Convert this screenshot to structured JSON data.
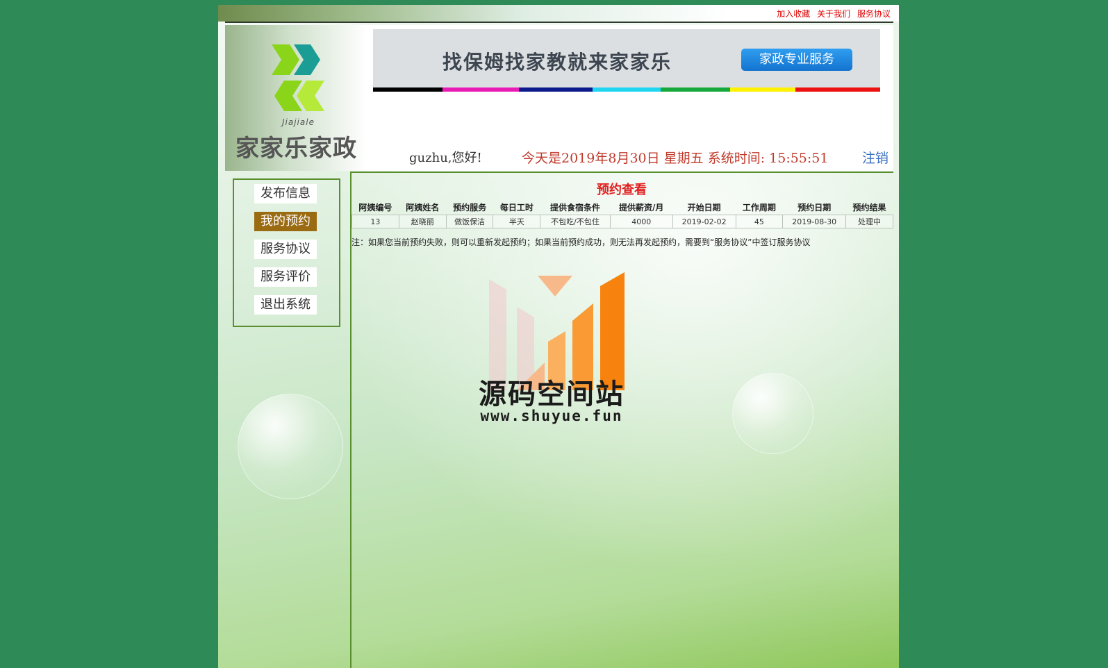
{
  "top_links": [
    "加入收藏",
    "关于我们",
    "服务协议"
  ],
  "logo": {
    "small_text": "Jiajiale",
    "name": "家家乐家政"
  },
  "banner": {
    "title": "找保姆找家教就来家家乐",
    "button": "家政专业服务",
    "stripe_colors": [
      "#000000",
      "#e81cb4",
      "#0d1a8c",
      "#20d5f0",
      "#16a83a",
      "#fff200",
      "#ee1111"
    ]
  },
  "user_bar": {
    "welcome": "guzhu,您好!",
    "datetime": "今天是2019年8月30日 星期五 系统时间: 15:55:51",
    "logout": "注销"
  },
  "sidebar": {
    "items": [
      {
        "label": "发布信息"
      },
      {
        "label": "我的预约"
      },
      {
        "label": "服务协议"
      },
      {
        "label": "服务评价"
      },
      {
        "label": "退出系统"
      }
    ]
  },
  "main": {
    "title": "预约查看",
    "columns": [
      "阿姨编号",
      "阿姨姓名",
      "预约服务",
      "每日工时",
      "提供食宿条件",
      "提供薪资/月",
      "开始日期",
      "工作周期",
      "预约日期",
      "预约结果"
    ],
    "rows": [
      [
        "13",
        "赵晓丽",
        "做饭保洁",
        "半天",
        "不包吃/不包住",
        "4000",
        "2019-02-02",
        "45",
        "2019-08-30",
        "处理中"
      ]
    ],
    "note": "注：如果您当前预约失败，则可以重新发起预约；如果当前预约成功，则无法再发起预约，需要到“服务协议”中签订服务协议"
  },
  "watermark": {
    "title": "源码空间站",
    "url": "www.shuyue.fun"
  },
  "colors": {
    "background": "#2e8b57",
    "accent_red": "#e02020",
    "menu_active": "#9b6b12",
    "border_green": "#5a8f2f"
  }
}
